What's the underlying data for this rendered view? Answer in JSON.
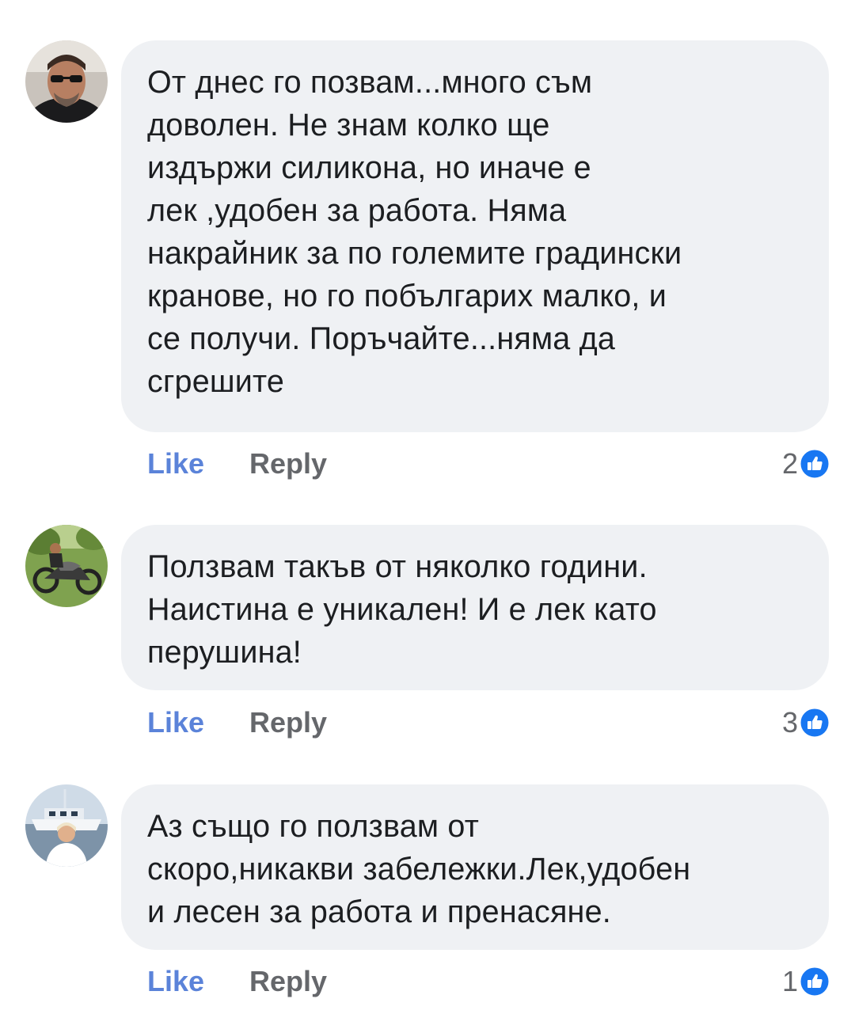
{
  "comments": [
    {
      "avatar_icon": "avatar-man-sunglasses",
      "text": "От  днес  го  позвам...много  съм\nдоволен. Не  знам  колко  ще\nиздържи  силикона, но иначе  е\nлек  ,удобен  за  работа.  Няма\nнакрайник за по  големите  градински\nкранове,  но  го  побългарих  малко, и\nсе  получи.  Поръчайте...няма да\nсгрешите",
      "like_label": "Like",
      "reply_label": "Reply",
      "reaction_count": "2",
      "reaction_icon": "thumbs-up-icon"
    },
    {
      "avatar_icon": "avatar-motorcycle",
      "text": "Ползвам такъв от няколко години.\nНаистина е уникален! И е лек като\nперушина!",
      "like_label": "Like",
      "reply_label": "Reply",
      "reaction_count": "3",
      "reaction_icon": "thumbs-up-icon"
    },
    {
      "avatar_icon": "avatar-woman-yacht",
      "text": "Аз също  го ползвам от\nскоро,никакви забележки.Лек,удобен\nи лесен за работа и пренасяне.",
      "like_label": "Like",
      "reply_label": "Reply",
      "reaction_count": "1",
      "reaction_icon": "thumbs-up-icon"
    }
  ],
  "colors": {
    "bubble": "#eff1f4",
    "text": "#1c1e21",
    "like": "#5b83d9",
    "muted": "#65676b",
    "reaction": "#1877f2"
  }
}
